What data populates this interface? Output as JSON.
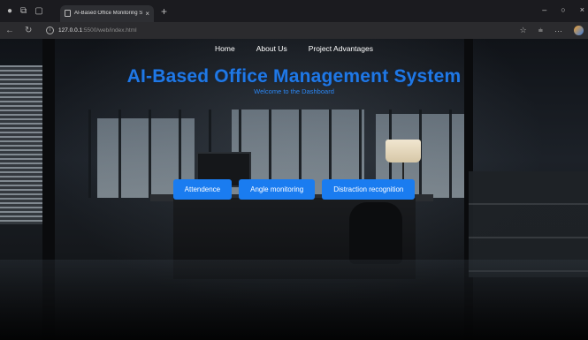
{
  "browser": {
    "tab_title": "AI-Based Office Monitoring Syste",
    "tab_close": "×",
    "new_tab": "+",
    "url_host": "127.0.0.1",
    "url_rest": ":5500/web/index.html",
    "window_controls": [
      "–",
      "○",
      "×"
    ],
    "icons": [
      "profile-icon",
      "tabs-icon",
      "page-icon",
      "back-icon",
      "refresh-icon",
      "info-icon",
      "favorite-icon",
      "collections-icon",
      "more-icon",
      "edge-profile-icon"
    ]
  },
  "nav": {
    "items": [
      {
        "label": "Home"
      },
      {
        "label": "About Us"
      },
      {
        "label": "Project Advantages"
      }
    ]
  },
  "hero": {
    "title": "AI-Based Office Management System",
    "subtitle": "Welcome to the Dashboard"
  },
  "actions": [
    {
      "label": "Attendence"
    },
    {
      "label": "Angle monitoring"
    },
    {
      "label": "Distraction recognition"
    }
  ],
  "colors": {
    "accent": "#1a7cf0",
    "title": "#1f78e6"
  }
}
